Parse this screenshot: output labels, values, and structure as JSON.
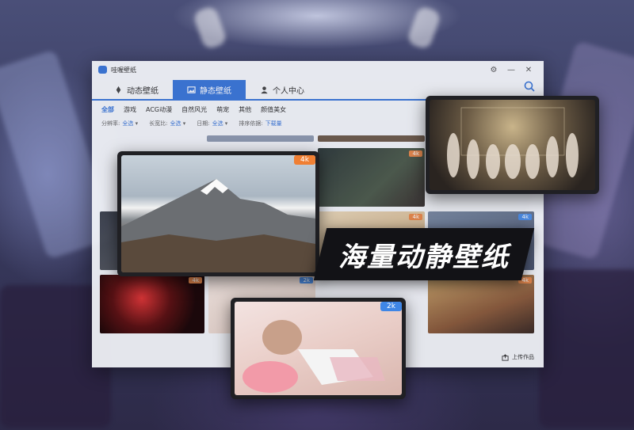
{
  "window": {
    "title": "哇喔壁纸"
  },
  "tabs": [
    {
      "label": "动态壁纸",
      "icon": "rocket-icon",
      "active": false
    },
    {
      "label": "静态壁纸",
      "icon": "image-icon",
      "active": true
    },
    {
      "label": "个人中心",
      "icon": "user-icon",
      "active": false
    }
  ],
  "categories": [
    "全部",
    "游戏",
    "ACG动漫",
    "自然风光",
    "萌宠",
    "其他",
    "颜值美女"
  ],
  "filters": [
    {
      "label": "分辨率:",
      "value": "全选"
    },
    {
      "label": "长宽比:",
      "value": "全选"
    },
    {
      "label": "日期:",
      "value": "全选"
    },
    {
      "label": "排序依据:",
      "value": "下载量"
    }
  ],
  "grid_badges": {
    "orange": "4k",
    "blue": "2k"
  },
  "upload_label": "上传作品",
  "cards": {
    "mountain_badge": "4k",
    "anime_badge": "2k"
  },
  "slogan": "海量动静壁纸",
  "colors": {
    "accent": "#3a76d8",
    "badge_4k": "#f07f33",
    "badge_2k": "#3f86e6"
  }
}
